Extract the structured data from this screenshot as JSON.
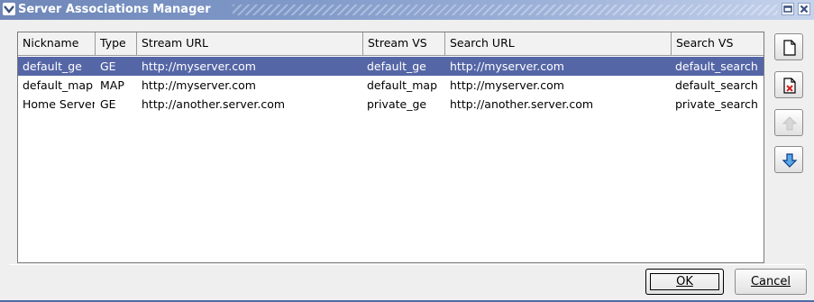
{
  "window": {
    "title": "Server Associations Manager"
  },
  "table": {
    "columns": [
      "Nickname",
      "Type",
      "Stream URL",
      "Stream VS",
      "Search URL",
      "Search VS"
    ],
    "rows": [
      {
        "nickname": "default_ge",
        "type": "GE",
        "stream_url": "http://myserver.com",
        "stream_vs": "default_ge",
        "search_url": "http://myserver.com",
        "search_vs": "default_search",
        "selected": true
      },
      {
        "nickname": "default_map",
        "type": "MAP",
        "stream_url": "http://myserver.com",
        "stream_vs": "default_map",
        "search_url": "http://myserver.com",
        "search_vs": "default_search",
        "selected": false
      },
      {
        "nickname": "Home Server",
        "type": "GE",
        "stream_url": "http://another.server.com",
        "stream_vs": "private_ge",
        "search_url": "http://another.server.com",
        "search_vs": "private_search",
        "selected": false
      }
    ]
  },
  "side_buttons": [
    {
      "icon": "new-document-icon"
    },
    {
      "icon": "delete-document-icon"
    },
    {
      "icon": "up-arrow-icon",
      "enabled": false
    },
    {
      "icon": "down-arrow-icon",
      "enabled": true
    }
  ],
  "buttons": {
    "ok_label": "OK",
    "cancel_label": "Cancel"
  },
  "colors": {
    "selection": "#5566a6",
    "titlebar": "#7e98c8"
  }
}
